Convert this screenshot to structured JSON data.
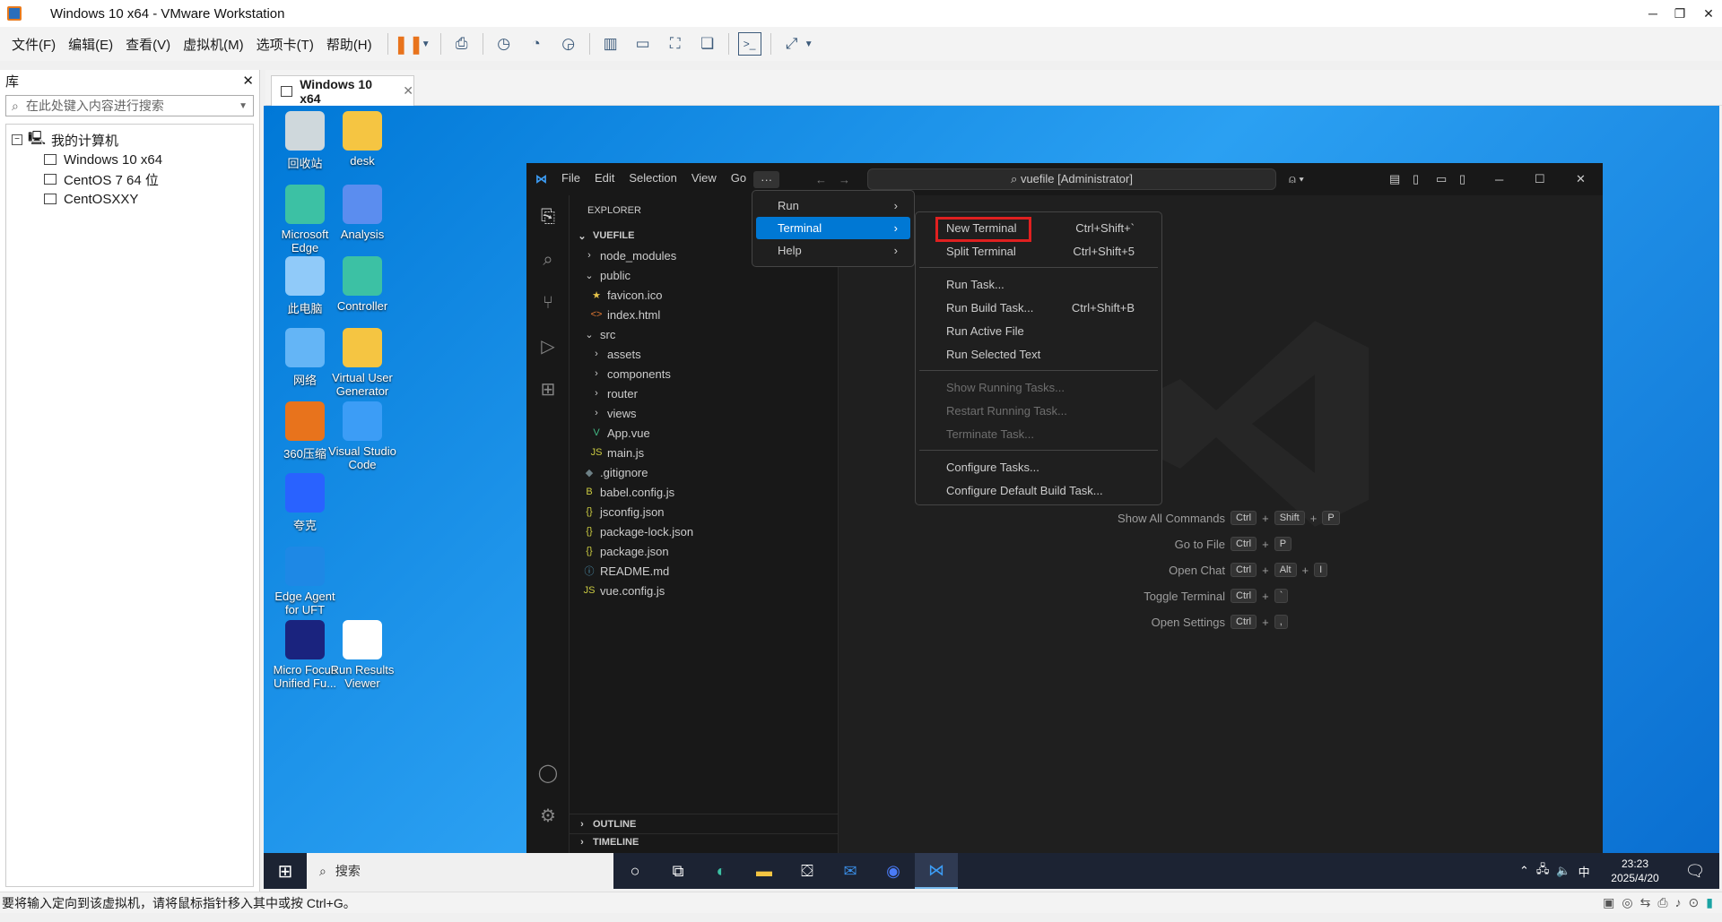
{
  "window": {
    "title": "Windows 10 x64 - VMware Workstation"
  },
  "menubar": {
    "items": [
      "文件(F)",
      "编辑(E)",
      "查看(V)",
      "虚拟机(M)",
      "选项卡(T)",
      "帮助(H)"
    ]
  },
  "library": {
    "title": "库",
    "search_placeholder": "在此处键入内容进行搜索",
    "root": "我的计算机",
    "vms": [
      "Windows 10 x64",
      "CentOS 7 64 位",
      "CentOSXXY"
    ]
  },
  "vmtab": {
    "label": "Windows 10 x64"
  },
  "desktop": {
    "icons": [
      "回收站",
      "desk",
      "Microsoft Edge",
      "Analysis",
      "此电脑",
      "Controller",
      "网络",
      "Virtual User Generator",
      "360压缩",
      "Visual Studio Code",
      "夸克",
      "Edge Agent for UFT",
      "Micro Focus Unified Fu...",
      "Run Results Viewer"
    ]
  },
  "vscode": {
    "menu": [
      "File",
      "Edit",
      "Selection",
      "View",
      "Go",
      "···"
    ],
    "command_center": "vuefile [Administrator]",
    "explorer_title": "EXPLORER",
    "folder": "VUEFILE",
    "tree": [
      {
        "name": "node_modules",
        "icon": "›",
        "indent": 1
      },
      {
        "name": "public",
        "icon": "⌄",
        "indent": 1
      },
      {
        "name": "favicon.ico",
        "icon": "★",
        "indent": 2
      },
      {
        "name": "index.html",
        "icon": "<>",
        "indent": 2
      },
      {
        "name": "src",
        "icon": "⌄",
        "indent": 1
      },
      {
        "name": "assets",
        "icon": "›",
        "indent": 2
      },
      {
        "name": "components",
        "icon": "›",
        "indent": 2
      },
      {
        "name": "router",
        "icon": "›",
        "indent": 2
      },
      {
        "name": "views",
        "icon": "›",
        "indent": 2
      },
      {
        "name": "App.vue",
        "icon": "V",
        "indent": 2
      },
      {
        "name": "main.js",
        "icon": "JS",
        "indent": 2
      },
      {
        "name": ".gitignore",
        "icon": "◆",
        "indent": 1
      },
      {
        "name": "babel.config.js",
        "icon": "B",
        "indent": 1
      },
      {
        "name": "jsconfig.json",
        "icon": "{}",
        "indent": 1
      },
      {
        "name": "package-lock.json",
        "icon": "{}",
        "indent": 1
      },
      {
        "name": "package.json",
        "icon": "{}",
        "indent": 1
      },
      {
        "name": "README.md",
        "icon": "ⓘ",
        "indent": 1
      },
      {
        "name": "vue.config.js",
        "icon": "JS",
        "indent": 1
      }
    ],
    "outline": "OUTLINE",
    "timeline": "TIMELINE",
    "shortcuts": [
      {
        "label": "Show All Commands",
        "keys": [
          "Ctrl",
          "Shift",
          "P"
        ]
      },
      {
        "label": "Go to File",
        "keys": [
          "Ctrl",
          "P"
        ]
      },
      {
        "label": "Open Chat",
        "keys": [
          "Ctrl",
          "Alt",
          "I"
        ]
      },
      {
        "label": "Toggle Terminal",
        "keys": [
          "Ctrl",
          "`"
        ]
      },
      {
        "label": "Open Settings",
        "keys": [
          "Ctrl",
          ","
        ]
      }
    ],
    "overflow_menu": [
      "Run",
      "Terminal",
      "Help"
    ],
    "terminal_menu": [
      {
        "label": "New Terminal",
        "shortcut": "Ctrl+Shift+`",
        "disabled": false
      },
      {
        "label": "Split Terminal",
        "shortcut": "Ctrl+Shift+5",
        "disabled": false
      },
      {
        "sep": true
      },
      {
        "label": "Run Task...",
        "shortcut": "",
        "disabled": false
      },
      {
        "label": "Run Build Task...",
        "shortcut": "Ctrl+Shift+B",
        "disabled": false
      },
      {
        "label": "Run Active File",
        "shortcut": "",
        "disabled": false
      },
      {
        "label": "Run Selected Text",
        "shortcut": "",
        "disabled": false
      },
      {
        "sep": true
      },
      {
        "label": "Show Running Tasks...",
        "shortcut": "",
        "disabled": true
      },
      {
        "label": "Restart Running Task...",
        "shortcut": "",
        "disabled": true
      },
      {
        "label": "Terminate Task...",
        "shortcut": "",
        "disabled": true
      },
      {
        "sep": true
      },
      {
        "label": "Configure Tasks...",
        "shortcut": "",
        "disabled": false
      },
      {
        "label": "Configure Default Build Task...",
        "shortcut": "",
        "disabled": false
      }
    ]
  },
  "taskbar": {
    "search": "搜索",
    "time": "23:23",
    "date": "2025/4/20",
    "ime": "中"
  },
  "statusbar": {
    "text": "要将输入定向到该虚拟机，请将鼠标指针移入其中或按 Ctrl+G。"
  },
  "colors": {
    "accent": "#0078d4",
    "highlight_box": "#e02020",
    "desktop": "#0078d7"
  }
}
